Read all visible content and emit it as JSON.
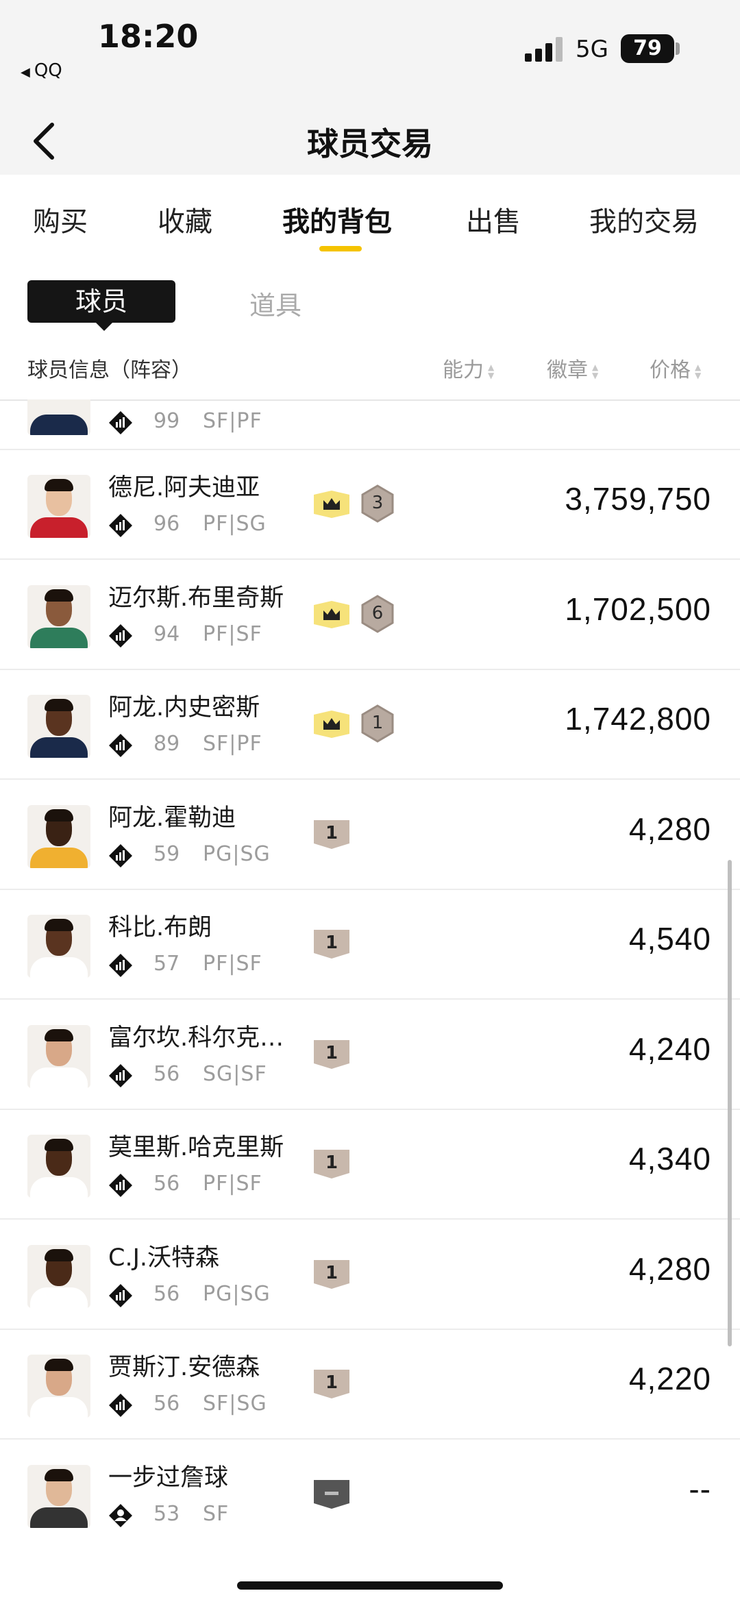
{
  "status_bar": {
    "time": "18:20",
    "back_app": "QQ",
    "network": "5G",
    "battery": "79"
  },
  "nav": {
    "title": "球员交易"
  },
  "tabs": [
    {
      "label": "购买",
      "active": false
    },
    {
      "label": "收藏",
      "active": false
    },
    {
      "label": "我的背包",
      "active": true
    },
    {
      "label": "出售",
      "active": false
    },
    {
      "label": "我的交易",
      "active": false
    }
  ],
  "segments": [
    {
      "label": "球员",
      "active": true
    },
    {
      "label": "道具",
      "active": false
    }
  ],
  "columns": {
    "info": "球员信息（阵容）",
    "ability": "能力",
    "badge": "徽章",
    "price": "价格"
  },
  "partial_row": {
    "rating": "99",
    "pos": "SF|PF"
  },
  "players": [
    {
      "name": "德尼.阿夫迪亚",
      "rating": "96",
      "pos": "PF|SG",
      "badge": "crown",
      "badge_level": "3",
      "price": "3,759,750",
      "ovr_icon": "chart-diamond-icon",
      "skin": "#e8c0a0",
      "jersey": "#c8202c"
    },
    {
      "name": "迈尔斯.布里奇斯",
      "rating": "94",
      "pos": "PF|SF",
      "badge": "crown",
      "badge_level": "6",
      "price": "1,702,500",
      "ovr_icon": "chart-diamond-icon",
      "skin": "#8a5a3c",
      "jersey": "#2e7d5b"
    },
    {
      "name": "阿龙.内史密斯",
      "rating": "89",
      "pos": "SF|PF",
      "badge": "crown",
      "badge_level": "1",
      "price": "1,742,800",
      "ovr_icon": "chart-diamond-icon",
      "skin": "#5a3420",
      "jersey": "#1a2a4a"
    },
    {
      "name": "阿龙.霍勒迪",
      "rating": "59",
      "pos": "PG|SG",
      "badge": "tag",
      "badge_level": "1",
      "price": "4,280",
      "ovr_icon": "chart-diamond-icon",
      "skin": "#3a2214",
      "jersey": "#f0b030"
    },
    {
      "name": "科比.布朗",
      "rating": "57",
      "pos": "PF|SF",
      "badge": "tag",
      "badge_level": "1",
      "price": "4,540",
      "ovr_icon": "chart-diamond-icon",
      "skin": "#5a3420",
      "jersey": "#ffffff"
    },
    {
      "name": "富尔坎.科尔克…",
      "rating": "56",
      "pos": "SG|SF",
      "badge": "tag",
      "badge_level": "1",
      "price": "4,240",
      "ovr_icon": "chart-diamond-icon",
      "skin": "#d8a888",
      "jersey": "#ffffff"
    },
    {
      "name": "莫里斯.哈克里斯",
      "rating": "56",
      "pos": "PF|SF",
      "badge": "tag",
      "badge_level": "1",
      "price": "4,340",
      "ovr_icon": "chart-diamond-icon",
      "skin": "#4a2a18",
      "jersey": "#ffffff"
    },
    {
      "name": "C.J.沃特森",
      "rating": "56",
      "pos": "PG|SG",
      "badge": "tag",
      "badge_level": "1",
      "price": "4,280",
      "ovr_icon": "chart-diamond-icon",
      "skin": "#4a2a18",
      "jersey": "#ffffff"
    },
    {
      "name": "贾斯汀.安德森",
      "rating": "56",
      "pos": "SF|SG",
      "badge": "tag",
      "badge_level": "1",
      "price": "4,220",
      "ovr_icon": "chart-diamond-icon",
      "skin": "#d8a888",
      "jersey": "#ffffff"
    },
    {
      "name": "一步过詹球",
      "rating": "53",
      "pos": "SF",
      "badge": "tag-gray",
      "badge_level": "",
      "price": "--",
      "ovr_icon": "person-diamond-icon",
      "skin": "#e0b898",
      "jersey": "#333333"
    }
  ],
  "colors": {
    "accent": "#f5c300",
    "crown_bg": "#f6e27a",
    "tag_bg": "#c8b8ac",
    "tag_gray": "#555555"
  }
}
